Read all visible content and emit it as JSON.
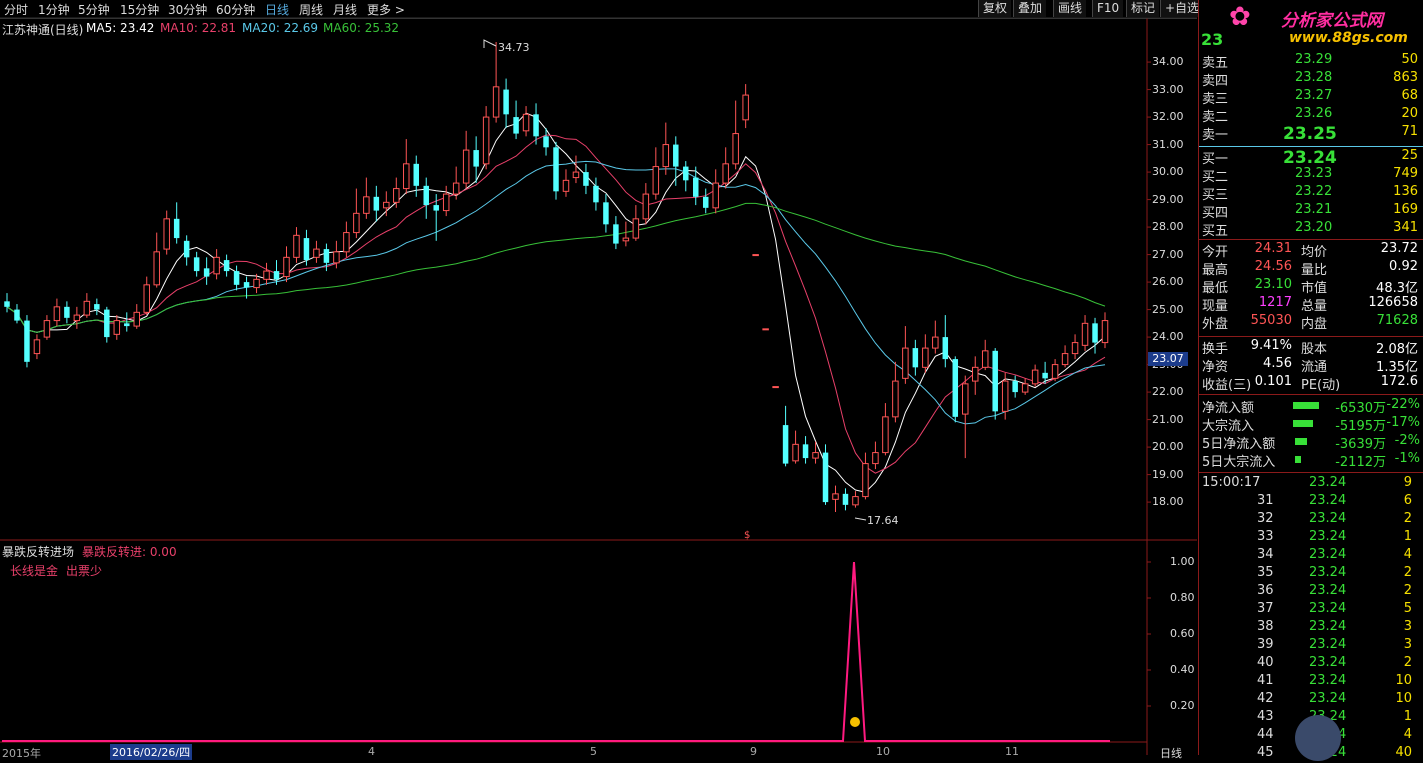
{
  "toolbar": {
    "periods": [
      "分时",
      "1分钟",
      "5分钟",
      "15分钟",
      "30分钟",
      "60分钟",
      "日线",
      "周线",
      "月线",
      "更多 >"
    ],
    "active_period": "日线",
    "right_buttons": [
      "复权",
      "叠加",
      "画线",
      "F10",
      "标记",
      "+自选"
    ]
  },
  "legend": {
    "stock": "江苏神通(日线)",
    "ma5": "MA5: 23.42",
    "ma10": "MA10: 22.81",
    "ma20": "MA20: 22.69",
    "ma60": "MA60: 25.32",
    "high_marker": "34.73",
    "low_marker": "17.64",
    "current_price_tag": "23.07"
  },
  "price_axis": [
    "34.00",
    "33.00",
    "32.00",
    "31.00",
    "30.00",
    "29.00",
    "28.00",
    "27.00",
    "26.00",
    "25.00",
    "24.00",
    "23.00",
    "22.00",
    "21.00",
    "20.00",
    "19.00",
    "18.00"
  ],
  "indicator": {
    "title": "暴跌反转进场",
    "value_label": "暴跌反转进: 0.00",
    "note1": "长线是金",
    "note2": "出票少",
    "axis": [
      "1.00",
      "0.80",
      "0.60",
      "0.40",
      "0.20"
    ]
  },
  "date_axis": {
    "year": "2015年",
    "cursor_date": "2016/02/26/四",
    "months": [
      "4",
      "5",
      "9",
      "10",
      "11"
    ],
    "period_label": "日线"
  },
  "colors": {
    "up": "#ff5555",
    "down": "#54ffff",
    "ma5": "#ffffff",
    "ma10": "#e8406a",
    "ma20": "#5ac8e8",
    "ma60": "#38c038",
    "frame": "#8b1a1a"
  },
  "candles": [
    [
      25.3,
      25.1,
      25.6,
      24.9
    ],
    [
      25.0,
      24.6,
      25.2,
      24.5
    ],
    [
      24.6,
      23.1,
      24.8,
      22.9
    ],
    [
      23.4,
      23.9,
      24.1,
      23.2
    ],
    [
      24.0,
      24.6,
      24.8,
      23.9
    ],
    [
      24.6,
      25.1,
      25.4,
      24.4
    ],
    [
      25.1,
      24.7,
      25.3,
      24.5
    ],
    [
      24.6,
      24.8,
      25.1,
      24.3
    ],
    [
      24.8,
      25.3,
      25.6,
      24.7
    ],
    [
      25.2,
      25.0,
      25.4,
      24.8
    ],
    [
      25.0,
      24.0,
      25.1,
      23.8
    ],
    [
      24.1,
      24.6,
      24.8,
      23.9
    ],
    [
      24.5,
      24.4,
      24.9,
      24.2
    ],
    [
      24.4,
      24.9,
      25.2,
      24.3
    ],
    [
      24.9,
      25.9,
      26.2,
      24.8
    ],
    [
      25.9,
      27.1,
      27.8,
      25.8
    ],
    [
      27.2,
      28.3,
      28.6,
      27.0
    ],
    [
      28.3,
      27.6,
      28.9,
      27.4
    ],
    [
      27.5,
      26.9,
      27.7,
      26.6
    ],
    [
      26.9,
      26.4,
      27.1,
      26.2
    ],
    [
      26.5,
      26.2,
      26.9,
      25.9
    ],
    [
      26.3,
      26.9,
      27.2,
      26.1
    ],
    [
      26.8,
      26.4,
      27.0,
      26.2
    ],
    [
      26.4,
      25.9,
      26.6,
      25.7
    ],
    [
      26.0,
      25.8,
      26.2,
      25.4
    ],
    [
      25.8,
      26.1,
      26.3,
      25.6
    ],
    [
      26.1,
      26.4,
      26.7,
      25.9
    ],
    [
      26.4,
      26.1,
      26.8,
      25.9
    ],
    [
      26.2,
      26.9,
      27.3,
      26.0
    ],
    [
      26.9,
      27.7,
      28.0,
      26.7
    ],
    [
      27.6,
      26.8,
      27.9,
      26.6
    ],
    [
      26.9,
      27.2,
      27.5,
      26.7
    ],
    [
      27.2,
      26.7,
      27.4,
      26.4
    ],
    [
      26.7,
      27.1,
      27.5,
      26.5
    ],
    [
      27.1,
      27.8,
      28.2,
      26.9
    ],
    [
      27.8,
      28.5,
      29.4,
      27.6
    ],
    [
      28.5,
      29.1,
      29.8,
      28.3
    ],
    [
      29.1,
      28.6,
      29.5,
      28.2
    ],
    [
      28.7,
      28.9,
      29.3,
      28.4
    ],
    [
      28.9,
      29.4,
      29.8,
      28.7
    ],
    [
      29.4,
      30.3,
      31.2,
      29.2
    ],
    [
      30.3,
      29.5,
      30.6,
      29.1
    ],
    [
      29.5,
      28.8,
      29.8,
      28.3
    ],
    [
      28.8,
      28.6,
      29.2,
      27.5
    ],
    [
      28.6,
      29.2,
      29.5,
      28.4
    ],
    [
      29.2,
      29.6,
      30.2,
      29.0
    ],
    [
      29.6,
      30.8,
      31.5,
      29.4
    ],
    [
      30.8,
      30.2,
      31.3,
      29.6
    ],
    [
      30.3,
      32.0,
      32.4,
      30.1
    ],
    [
      32.0,
      33.1,
      34.73,
      31.8
    ],
    [
      33.0,
      32.1,
      33.4,
      31.6
    ],
    [
      32.0,
      31.4,
      32.6,
      31.2
    ],
    [
      31.5,
      32.1,
      32.4,
      31.3
    ],
    [
      32.1,
      31.3,
      32.5,
      31.0
    ],
    [
      31.3,
      30.9,
      31.6,
      30.6
    ],
    [
      30.9,
      29.3,
      31.1,
      29.0
    ],
    [
      29.3,
      29.7,
      30.1,
      29.1
    ],
    [
      29.8,
      30.0,
      30.6,
      29.6
    ],
    [
      30.0,
      29.5,
      30.3,
      29.2
    ],
    [
      29.5,
      28.9,
      29.8,
      28.6
    ],
    [
      28.9,
      28.1,
      29.2,
      27.8
    ],
    [
      28.1,
      27.4,
      28.4,
      27.2
    ],
    [
      27.5,
      27.6,
      28.2,
      27.3
    ],
    [
      27.6,
      28.3,
      28.8,
      27.5
    ],
    [
      28.3,
      29.2,
      29.6,
      28.1
    ],
    [
      29.2,
      30.2,
      30.9,
      29.0
    ],
    [
      30.2,
      31.0,
      31.8,
      29.9
    ],
    [
      31.0,
      30.2,
      31.3,
      29.5
    ],
    [
      30.2,
      29.7,
      30.4,
      29.3
    ],
    [
      29.8,
      29.1,
      30.2,
      28.8
    ],
    [
      29.1,
      28.7,
      29.4,
      28.5
    ],
    [
      28.7,
      29.6,
      30.1,
      28.5
    ],
    [
      29.6,
      30.3,
      30.9,
      29.4
    ],
    [
      30.3,
      31.4,
      32.6,
      30.1
    ],
    [
      31.9,
      32.8,
      33.2,
      31.6
    ],
    [
      27.0,
      27.0,
      27.0,
      27.0
    ],
    [
      24.3,
      24.3,
      24.3,
      24.3
    ],
    [
      22.2,
      22.2,
      22.2,
      22.2
    ],
    [
      20.8,
      19.4,
      21.5,
      19.3
    ],
    [
      19.5,
      20.1,
      20.6,
      19.4
    ],
    [
      20.1,
      19.6,
      20.4,
      19.4
    ],
    [
      19.6,
      19.8,
      20.2,
      19.4
    ],
    [
      19.8,
      18.0,
      20.1,
      17.9
    ],
    [
      18.1,
      18.3,
      18.6,
      17.64
    ],
    [
      18.3,
      17.9,
      18.5,
      17.7
    ],
    [
      17.9,
      18.2,
      18.4,
      17.8
    ],
    [
      18.2,
      19.4,
      19.8,
      18.1
    ],
    [
      19.4,
      19.8,
      20.2,
      19.2
    ],
    [
      19.8,
      21.1,
      21.6,
      19.7
    ],
    [
      21.1,
      22.4,
      23.1,
      20.9
    ],
    [
      22.5,
      23.6,
      24.4,
      22.3
    ],
    [
      23.6,
      22.9,
      23.9,
      22.6
    ],
    [
      22.9,
      23.6,
      24.1,
      22.7
    ],
    [
      23.6,
      24.0,
      24.6,
      23.4
    ],
    [
      24.0,
      23.2,
      24.8,
      22.9
    ],
    [
      23.2,
      21.1,
      23.3,
      20.9
    ],
    [
      21.2,
      22.3,
      22.6,
      19.6
    ],
    [
      22.4,
      22.9,
      23.3,
      21.9
    ],
    [
      22.9,
      23.5,
      23.9,
      22.8
    ],
    [
      23.5,
      21.3,
      23.6,
      21.0
    ],
    [
      21.3,
      22.4,
      22.7,
      21.0
    ],
    [
      22.4,
      22.0,
      22.6,
      21.8
    ],
    [
      22.0,
      22.3,
      22.5,
      21.9
    ],
    [
      22.3,
      22.8,
      23.0,
      22.2
    ],
    [
      22.7,
      22.5,
      23.1,
      22.3
    ],
    [
      22.5,
      23.0,
      23.2,
      22.4
    ],
    [
      23.0,
      23.4,
      23.7,
      22.9
    ],
    [
      23.4,
      23.8,
      24.1,
      23.2
    ],
    [
      23.7,
      24.5,
      24.8,
      23.5
    ],
    [
      24.5,
      23.8,
      24.7,
      23.4
    ],
    [
      23.8,
      24.6,
      24.9,
      23.6
    ]
  ],
  "panel": {
    "code": "23",
    "watermark_title": "分析家公式网",
    "watermark_url": "www.88gs.com",
    "ask": [
      [
        "卖五",
        "23.29",
        "50"
      ],
      [
        "卖四",
        "23.28",
        "863"
      ],
      [
        "卖三",
        "23.27",
        "68"
      ],
      [
        "卖二",
        "23.26",
        "20"
      ],
      [
        "卖一",
        "23.25",
        "71"
      ]
    ],
    "bid": [
      [
        "买一",
        "23.24",
        "25"
      ],
      [
        "买二",
        "23.23",
        "749"
      ],
      [
        "买三",
        "23.22",
        "136"
      ],
      [
        "买四",
        "23.21",
        "169"
      ],
      [
        "买五",
        "23.20",
        "341"
      ]
    ],
    "stats1": [
      [
        "今开",
        "24.31",
        "均价",
        "23.72"
      ],
      [
        "最高",
        "24.56",
        "量比",
        "0.92"
      ],
      [
        "最低",
        "23.10",
        "市值",
        "48.3亿"
      ],
      [
        "现量",
        "1217",
        "总量",
        "126658"
      ],
      [
        "外盘",
        "55030",
        "内盘",
        "71628"
      ]
    ],
    "stats2": [
      [
        "换手",
        "9.41%",
        "股本",
        "2.08亿"
      ],
      [
        "净资",
        "4.56",
        "流通",
        "1.35亿"
      ],
      [
        "收益(三)",
        "0.101",
        "PE(动)",
        "172.6"
      ]
    ],
    "flows": [
      [
        "净流入额",
        "-6530万",
        "-22%"
      ],
      [
        "大宗流入",
        "-5195万",
        "-17%"
      ],
      [
        "5日净流入额",
        "-3639万",
        "-2%"
      ],
      [
        "5日大宗流入",
        "-2112万",
        "-1%"
      ]
    ],
    "ticks": [
      [
        "15:00:17",
        "23.24",
        "9"
      ],
      [
        "31",
        "23.24",
        "6"
      ],
      [
        "32",
        "23.24",
        "2"
      ],
      [
        "33",
        "23.24",
        "1"
      ],
      [
        "34",
        "23.24",
        "4"
      ],
      [
        "35",
        "23.24",
        "2"
      ],
      [
        "36",
        "23.24",
        "2"
      ],
      [
        "37",
        "23.24",
        "5"
      ],
      [
        "38",
        "23.24",
        "3"
      ],
      [
        "39",
        "23.24",
        "3"
      ],
      [
        "40",
        "23.24",
        "2"
      ],
      [
        "41",
        "23.24",
        "10"
      ],
      [
        "42",
        "23.24",
        "10"
      ],
      [
        "43",
        "23.24",
        "1"
      ],
      [
        "44",
        "23.24",
        "4"
      ],
      [
        "45",
        "23.24",
        "40"
      ]
    ]
  }
}
